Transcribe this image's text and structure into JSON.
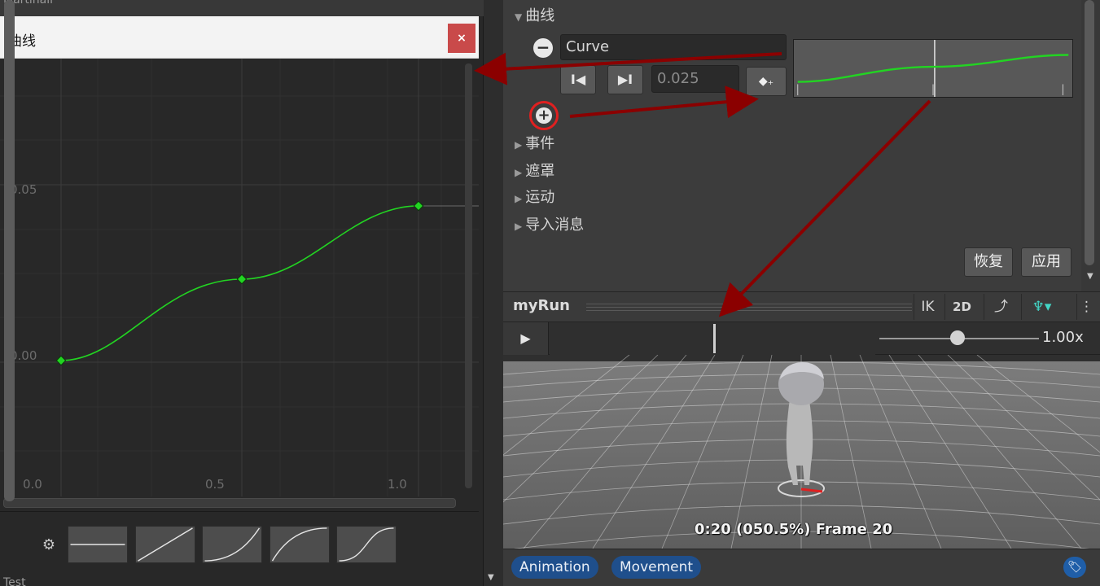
{
  "curve_window": {
    "behind_title": "Martinail",
    "title": "曲线",
    "close_label": "×",
    "gear_icon": "⚙",
    "bottom_label": "Test",
    "y_ticks": [
      "0.05",
      "0.00"
    ],
    "x_ticks": [
      "0.0",
      "0.5",
      "1.0"
    ],
    "presets": [
      "constant",
      "linear",
      "ease-in",
      "ease-out",
      "ease-in-out"
    ],
    "curve_color": "#22d422"
  },
  "inspector": {
    "section_curves": "曲线",
    "curve_name": "Curve",
    "remove_icon": "−",
    "prev_key": "I◀",
    "next_key": "▶I",
    "curve_value": "0.025",
    "add_key": "◆₊",
    "add_curve_icon": "+",
    "folds": [
      "事件",
      "遮罩",
      "运动",
      "导入消息"
    ],
    "revert": "恢复",
    "apply": "应用"
  },
  "preview": {
    "clip_name": "myRun",
    "ik": "IK",
    "twod": "2D",
    "speed": "1.00x",
    "frame_info": "0:20 (050.5%) Frame 20",
    "play_icon": "▶"
  },
  "bottom_bar": {
    "tags": [
      "Animation",
      "Movement"
    ],
    "label_icon": "🏷"
  },
  "colors": {
    "annotation_arrow": "#8b0000",
    "highlight": "#e02020",
    "curve": "#22d422"
  }
}
